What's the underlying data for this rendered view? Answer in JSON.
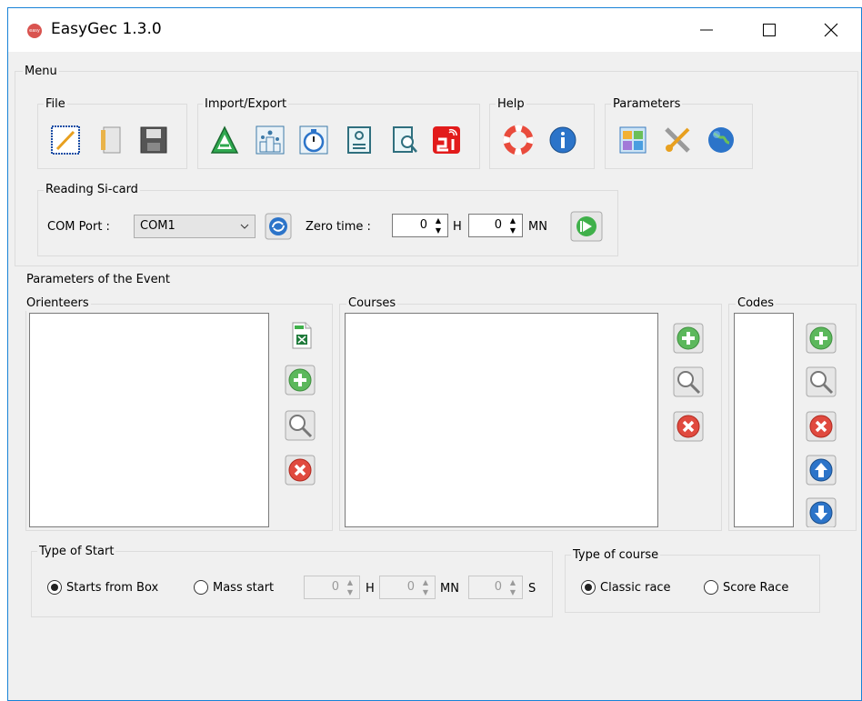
{
  "window": {
    "title": "EasyGec 1.3.0",
    "app_icon_text": "easy"
  },
  "menu": {
    "title": "Menu",
    "file": {
      "title": "File",
      "buttons": [
        "new-file-icon",
        "open-file-icon",
        "save-file-icon"
      ]
    },
    "import_export": {
      "title": "Import/Export",
      "buttons": [
        "import-a-icon",
        "podium-icon",
        "stopwatch-icon",
        "contact-card-icon",
        "search-document-icon",
        "si-logo-icon"
      ]
    },
    "help": {
      "title": "Help",
      "buttons": [
        "lifebuoy-icon",
        "info-icon"
      ]
    },
    "parameters": {
      "title": "Parameters",
      "buttons": [
        "layout-icon",
        "tools-icon",
        "globe-icon"
      ]
    }
  },
  "reading": {
    "title": "Reading Si-card",
    "com_port_label": "COM Port :",
    "com_port_value": "COM1",
    "zero_time_label": "Zero time :",
    "hours_value": "0",
    "hours_unit": "H",
    "minutes_value": "0",
    "minutes_unit": "MN"
  },
  "event": {
    "title": "Parameters of the Event",
    "orienteers_title": "Orienteers",
    "courses_title": "Courses",
    "codes_title": "Codes"
  },
  "start_type": {
    "title": "Type of Start",
    "option1": "Starts from Box",
    "option2": "Mass start",
    "selected": "Starts from Box",
    "h_value": "0",
    "h_unit": "H",
    "mn_value": "0",
    "mn_unit": "MN",
    "s_value": "0",
    "s_unit": "S"
  },
  "course_type": {
    "title": "Type of course",
    "option1": "Classic race",
    "option2": "Score Race",
    "selected": "Classic race"
  },
  "colors": {
    "title_border": "#1883d7",
    "panel_bg": "#f0f0f0",
    "accent_green": "#5cb85c",
    "accent_red": "#d9534f",
    "accent_blue": "#2c74c9"
  }
}
